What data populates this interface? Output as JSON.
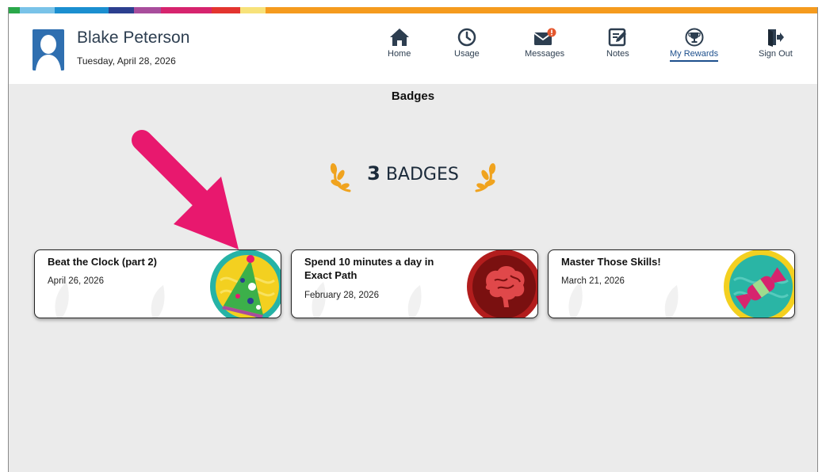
{
  "colors": {
    "stripe": [
      "#2aa84a",
      "#79c3e8",
      "#1b8fd0",
      "#2c3f8f",
      "#a84d9c",
      "#d6246e",
      "#e3342f",
      "#f7e27a",
      "#f59b1e"
    ],
    "header_text": "#2d3e50",
    "active_nav": "#1d4f8c",
    "arrow": "#e8186e",
    "laurel": "#f0a31e"
  },
  "user": {
    "name": "Blake Peterson",
    "date": "Tuesday, April 28, 2026",
    "avatar_icon": "user-silhouette-icon"
  },
  "nav": [
    {
      "label": "Home",
      "icon": "home-icon"
    },
    {
      "label": "Usage",
      "icon": "clock-icon"
    },
    {
      "label": "Messages",
      "icon": "envelope-alert-icon"
    },
    {
      "label": "Notes",
      "icon": "notepad-pencil-icon"
    },
    {
      "label": "My Rewards",
      "icon": "trophy-icon",
      "active": true
    },
    {
      "label": "Sign Out",
      "icon": "sign-out-icon"
    }
  ],
  "page_title": "Badges",
  "badge_count": {
    "number": "3",
    "label": "BADGES"
  },
  "badges": [
    {
      "title": "Beat the Clock (part 2)",
      "date": "April 26, 2026",
      "icon": "party-hat-icon"
    },
    {
      "title": "Spend 10 minutes a day in Exact Path",
      "date": "February 28, 2026",
      "icon": "brain-icon"
    },
    {
      "title": "Master Those Skills!",
      "date": "March 21, 2026",
      "icon": "candy-icon"
    }
  ]
}
